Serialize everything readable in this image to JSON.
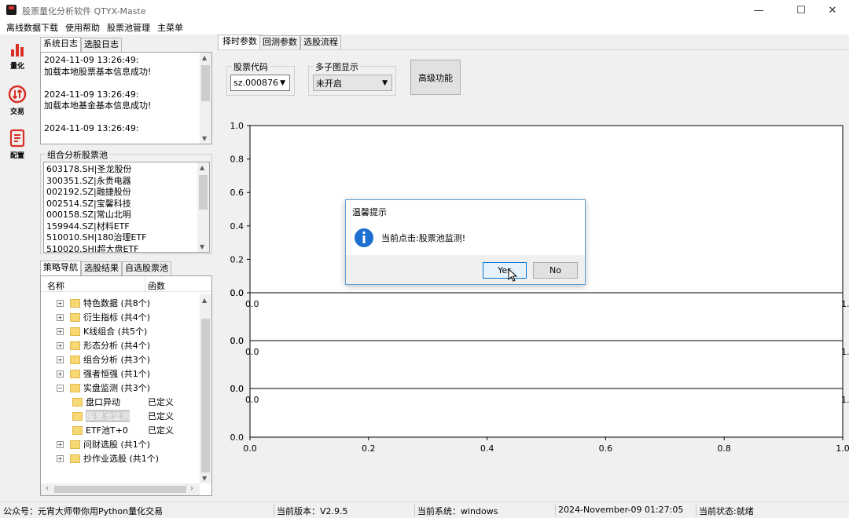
{
  "window": {
    "title": "股票量化分析软件 QTYX-Maste",
    "minimize": "—",
    "maximize": "☐",
    "close": "✕"
  },
  "menu": [
    "离线数据下载",
    "使用帮助",
    "股票池管理",
    "主菜单"
  ],
  "sidebar": [
    {
      "label": "量化",
      "icon": "bar-chart-icon"
    },
    {
      "label": "交易",
      "icon": "exchange-icon"
    },
    {
      "label": "配置",
      "icon": "document-icon"
    }
  ],
  "log": {
    "tabs": [
      "系统日志",
      "选股日志"
    ],
    "lines": [
      "2024-11-09 13:26:49:",
      "加载本地股票基本信息成功!",
      "",
      "2024-11-09 13:26:49:",
      "加载本地基金基本信息成功!",
      "",
      "2024-11-09 13:26:49:"
    ]
  },
  "pool": {
    "title": "组合分析股票池",
    "items": [
      "603178.SH|圣龙股份",
      "300351.SZ|永贵电器",
      "002192.SZ|融捷股份",
      "002514.SZ|宝馨科技",
      "000158.SZ|常山北明",
      "159944.SZ|材料ETF",
      "510010.SH|180治理ETF",
      "510020.SH|超大盘ETF"
    ]
  },
  "strategy": {
    "tabs": [
      "策略导航",
      "选股结果",
      "自选股票池"
    ],
    "col_name": "名称",
    "col_func": "函数",
    "rows": [
      {
        "exp": "⊞",
        "name": "特色数据 (共8个)",
        "func": "",
        "level": 0
      },
      {
        "exp": "⊞",
        "name": "衍生指标 (共4个)",
        "func": "",
        "level": 0
      },
      {
        "exp": "⊞",
        "name": "K线组合 (共5个)",
        "func": "",
        "level": 0
      },
      {
        "exp": "⊞",
        "name": "形态分析 (共4个)",
        "func": "",
        "level": 0
      },
      {
        "exp": "⊞",
        "name": "组合分析 (共3个)",
        "func": "",
        "level": 0
      },
      {
        "exp": "⊞",
        "name": "强者恒强 (共1个)",
        "func": "",
        "level": 0
      },
      {
        "exp": "⊟",
        "name": "实盘监测 (共3个)",
        "func": "",
        "level": 0
      },
      {
        "exp": "",
        "name": "盘口异动",
        "func": "已定义",
        "level": 1
      },
      {
        "exp": "",
        "name": "股票池监测",
        "func": "已定义",
        "level": 1,
        "selected": true
      },
      {
        "exp": "",
        "name": "ETF池T+0",
        "func": "已定义",
        "level": 1
      },
      {
        "exp": "⊞",
        "name": "问财选股 (共1个)",
        "func": "",
        "level": 0
      },
      {
        "exp": "⊞",
        "name": "抄作业选股 (共1个)",
        "func": "",
        "level": 0
      }
    ]
  },
  "main": {
    "tabs": [
      "择时参数",
      "回测参数",
      "选股流程"
    ],
    "stock_code": {
      "label": "股票代码",
      "value": "sz.000876"
    },
    "subplot": {
      "label": "多子图显示",
      "value": "未开启"
    },
    "advanced_button": "高级功能"
  },
  "chart_data": {
    "type": "line",
    "main_plot": {
      "yticks": [
        "0.0",
        "0.2",
        "0.4",
        "0.6",
        "0.8",
        "1.0"
      ]
    },
    "subplots": [
      {
        "yticks": [
          "0.0",
          "0.0"
        ]
      },
      {
        "yticks": [
          "0.0",
          "0.0"
        ]
      },
      {
        "yticks": [
          "0.0",
          "0.0"
        ]
      }
    ],
    "xticks": [
      "0.0",
      "0.2",
      "0.4",
      "0.6",
      "0.8",
      "1.0"
    ],
    "xlim": [
      0,
      1
    ],
    "ylim": [
      0,
      1
    ]
  },
  "dialog": {
    "title": "温馨提示",
    "message": "当前点击:股票池监测!",
    "yes": "Yes",
    "no": "No"
  },
  "status": [
    "公众号：元宵大师带你用Python量化交易",
    "当前版本：V2.9.5",
    "当前系统：windows",
    "2024-November-09 01:27:05",
    "当前状态:就绪"
  ]
}
